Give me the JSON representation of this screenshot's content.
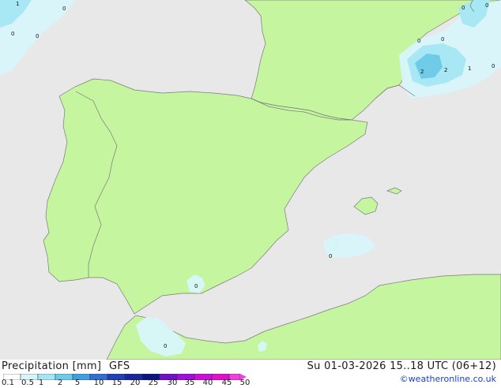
{
  "map": {
    "region": "Iberian Peninsula",
    "colors": {
      "sea": "#e8e8e8",
      "land": "#c6f5a0",
      "border": "#7a7a7a",
      "precip_light": "#d8f6fb",
      "precip_mid": "#a8e8f4",
      "precip_heavy": "#6fcbe8"
    },
    "contour_labels": [
      {
        "text": "1"
      },
      {
        "text": "0"
      },
      {
        "text": "0"
      },
      {
        "text": "0"
      },
      {
        "text": "0"
      },
      {
        "text": "0"
      },
      {
        "text": "0"
      },
      {
        "text": "0"
      },
      {
        "text": "2"
      },
      {
        "text": "2"
      },
      {
        "text": "1"
      },
      {
        "text": "0"
      },
      {
        "text": "0"
      },
      {
        "text": "0"
      },
      {
        "text": "0"
      }
    ]
  },
  "legend": {
    "title": "Precipitation [mm]",
    "model": "GFS",
    "ticks": [
      "0.1",
      "0.5",
      "1",
      "2",
      "5",
      "10",
      "15",
      "20",
      "25",
      "30",
      "35",
      "40",
      "45",
      "50"
    ],
    "colors": [
      "#ffffff",
      "#d6f5fb",
      "#a4e6f4",
      "#6ecbe8",
      "#3f9fdf",
      "#2f6fd0",
      "#2040b8",
      "#1826a0",
      "#0c1480",
      "#7010c8",
      "#a010d8",
      "#c810d8",
      "#e010c8",
      "#f040e0"
    ]
  },
  "forecast_time": "Su 01-03-2026 15..18 UTC (06+12)",
  "credit": "©weatheronline.co.uk"
}
